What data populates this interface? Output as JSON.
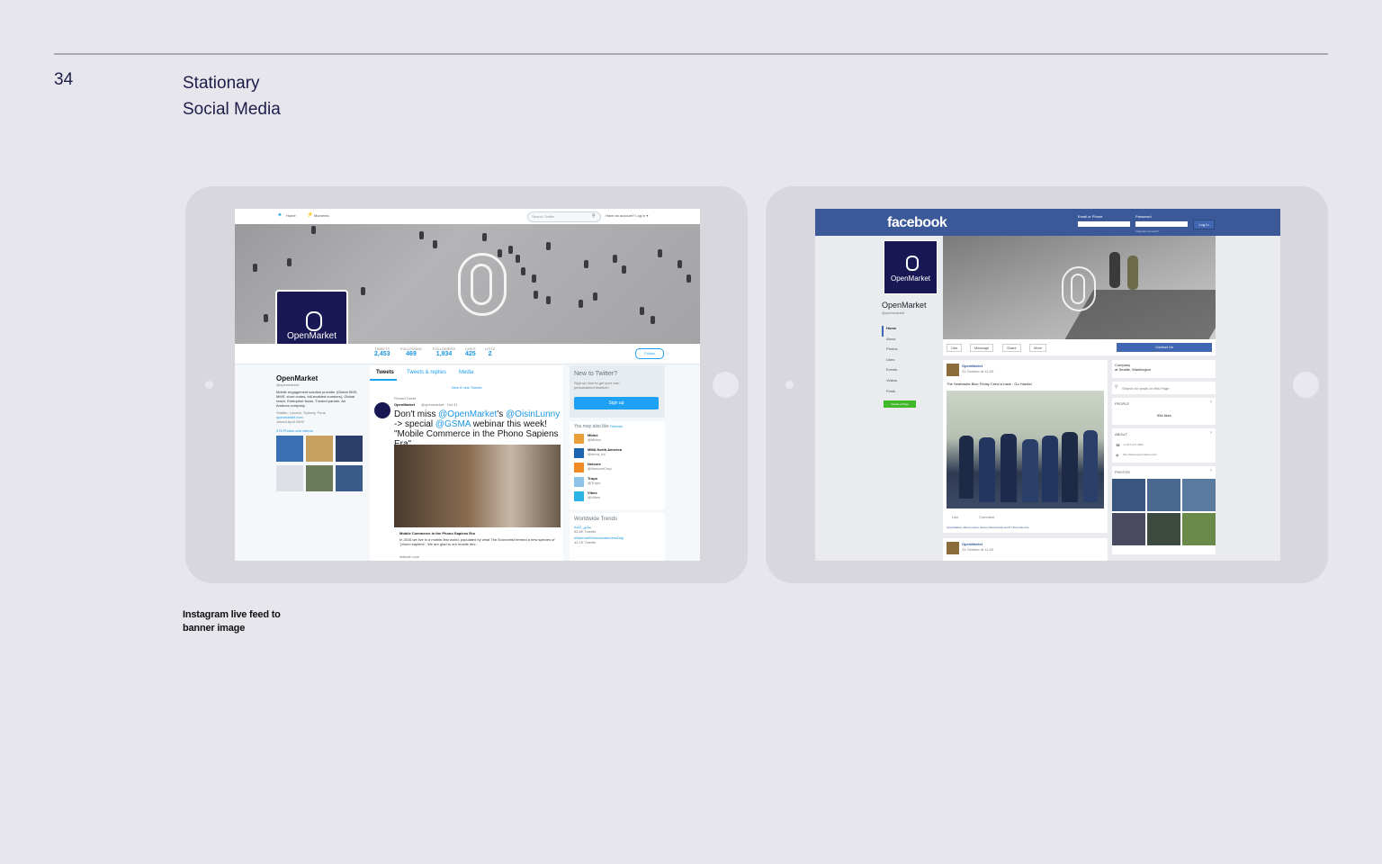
{
  "page": {
    "number": "34",
    "title": "Stationary",
    "subtitle": "Social Media",
    "caption_line1": "Instagram live feed to",
    "caption_line2": "banner image"
  },
  "twitter": {
    "nav_home": "Home",
    "nav_moments": "Moments",
    "search_placeholder": "Search Twitter",
    "login_text": "Have an account? Log in ▾",
    "stats": [
      {
        "label": "TWEETS",
        "value": "2,453"
      },
      {
        "label": "FOLLOWING",
        "value": "469"
      },
      {
        "label": "FOLLOWERS",
        "value": "1,934"
      },
      {
        "label": "LIKES",
        "value": "425"
      },
      {
        "label": "LISTS",
        "value": "2"
      }
    ],
    "follow": "Follow",
    "profile_name": "OpenMarket",
    "handle": "@openmarket",
    "bio": "Mobile engagement solution provider (Global SMS, MMS, short codes, toll-enabled numbers). Global reach. Enterprise focus. Trusted partner. An Amdocs company.",
    "location": "Seattle, London, Sydney, Pune",
    "website": "openmarket.com",
    "joined": "Joined April 2009",
    "photos_link": "376 Photos and videos",
    "tabs": [
      "Tweets",
      "Tweets & replies",
      "Media"
    ],
    "new_tweets": "View 6 new Tweets",
    "pinned": "Pinned Tweet",
    "tweet_author": "OpenMarket",
    "tweet_meta": "@openmarket · Oct 31",
    "tweet_p1": "Don't miss ",
    "tweet_m1": "@OpenMarket",
    "tweet_p2": "'s ",
    "tweet_m2": "@OisinLunny",
    "tweet_p3": " -> special ",
    "tweet_m3": "@GSMA",
    "tweet_p4": " webinar this week! \"Mobile Commerce in the Phono Sapiens Era\"",
    "card_title": "Mobile Commerce in the Phono Sapiens Era",
    "card_desc": "In 2016 we live in a mobile-first world, populated by what The Economist termed a new species of \"phono sapiens\". We are glad to our mobile dev...",
    "card_link": "linkedin.com",
    "new_to": "New to Twitter?",
    "new_to_sub": "Sign up now to get your own personalized timeline!",
    "signup": "Sign up",
    "also_like": "You may also like",
    "refresh": "Refresh",
    "suggestions": [
      {
        "name": "Mblox",
        "handle": "@Mblox"
      },
      {
        "name": "MMA North America",
        "handle": "@mma_na"
      },
      {
        "name": "Netcore",
        "handle": "@NetcoreCorp"
      },
      {
        "name": "Tropo",
        "handle": "@Tropo"
      },
      {
        "name": "Vibes",
        "handle": "@Vibes"
      }
    ],
    "trends_title": "Worldwide Trends",
    "trend1": "#سائق_ابلة",
    "trend1_count": "54.8K Tweets",
    "trend2": "#NationalStressAwarenessDay",
    "trend2_count": "42.1K Tweets"
  },
  "facebook": {
    "logo": "facebook",
    "email_label": "Email or Phone",
    "password_label": "Password",
    "login": "Log In",
    "forgot": "Forgotten account?",
    "page_name": "OpenMarket",
    "page_handle": "@openmarket",
    "nav": [
      "Home",
      "About",
      "Photos",
      "Likes",
      "Events",
      "Videos",
      "Posts"
    ],
    "create_page": "Create a Page",
    "actions": [
      "Like",
      "Message",
      "Share",
      "More"
    ],
    "contact": "Contact Us",
    "post_author": "OpenMarket",
    "post_date": "31 October at 11:00 ·",
    "post_text": "The Seahawks Blue Friday Crew is back - Go Hawks!",
    "like": "Like",
    "comment": "Comment",
    "post_likes": "OpenMarket, Albert Lupisa, Steven Wormwolds and 8 others like this.",
    "post2_author": "OpenMarket",
    "post2_date": "31 October at 11:00",
    "category": "Company",
    "location": "at Seattle, Washington",
    "search_posts": "Search for posts on this Page",
    "people": "PEOPLE",
    "likes_count": "556 likes",
    "about": "ABOUT",
    "phone": "+1 877-277-2801",
    "website": "http://www.openmarket.com/",
    "photos": "PHOTOS"
  }
}
